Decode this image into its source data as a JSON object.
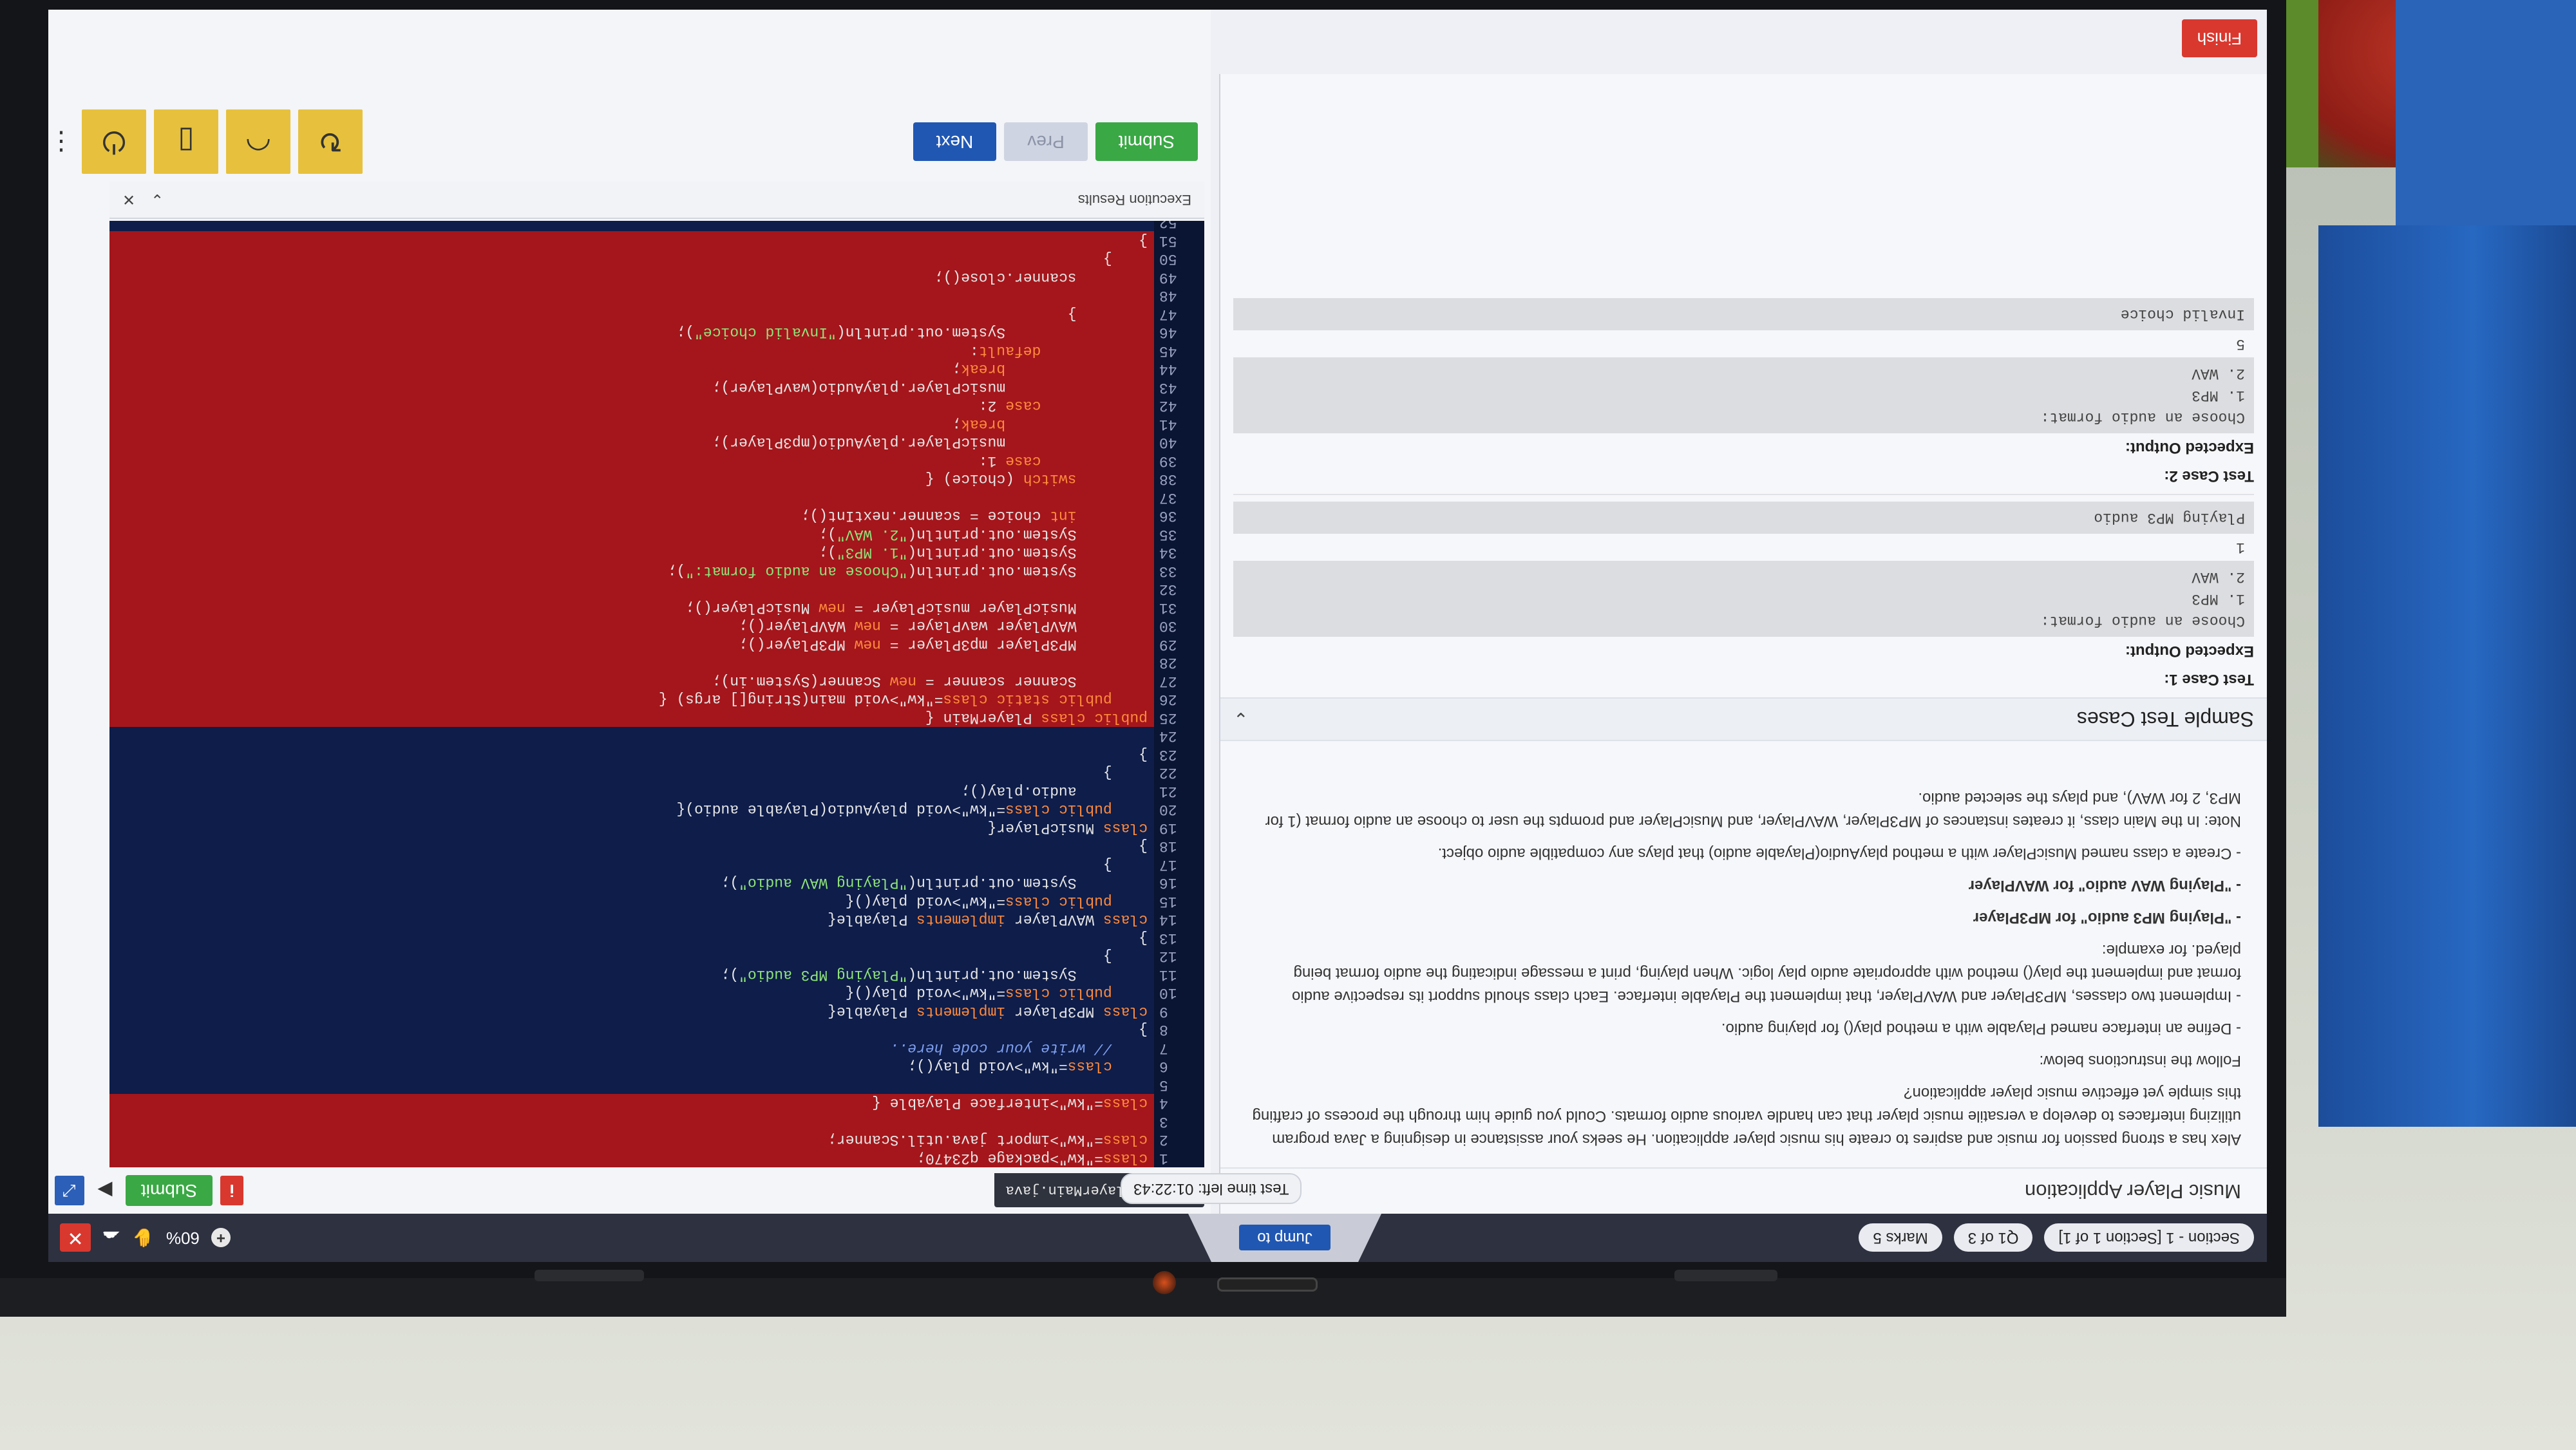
{
  "topbar": {
    "section": "Section - 1 [Section 1 of 1]",
    "question": "Q1 of 3",
    "marks": "Marks 5",
    "jump": "Jump to",
    "zoom": "60%",
    "timer": "Test time left: 01:22:43"
  },
  "question": {
    "title": "Music Player Application",
    "paragraphs": [
      "Alex has a strong passion for music and aspires to create his music player application. He seeks your assistance in designing a Java program utilizing interfaces to develop a versatile music player that can handle various audio formats. Could you guide him through the process of crafting this simple yet effective music player application?",
      "Follow the instructions below:",
      "- Define an interface named Playable with a method play() for playing audio.",
      "- Implement two classes, MP3Player and WAVPlayer, that implement the Playable interface. Each class should support its respective audio format and implement the play() method with appropriate audio play logic. When playing, print a message indicating the audio format being played. for example:",
      "- \"Playing MP3 audio\" for MP3Player",
      "- \"Playing WAV audio\" for WAVPlayer",
      "- Create a class named MusicPlayer with a method playAudio(Playable audio) that plays any compatible audio object.",
      "Note: In the Main class, it creates instances of MP3Player, WAVPlayer, and MusicPlayer and prompts the user to choose an audio format (1 for MP3, 2 for WAV), and plays the selected audio."
    ],
    "sample_title": "Sample Test Cases",
    "test_cases": [
      {
        "label": "Test Case 1:",
        "expected_label": "Expected Output:",
        "box1": "Choose an audio format:\n1. MP3\n2. WAV",
        "input": "1",
        "box2": "Playing MP3 audio"
      },
      {
        "label": "Test Case 2:",
        "expected_label": "Expected Output:",
        "box1": "Choose an audio format:\n1. MP3\n2. WAV",
        "input": "5",
        "box2": "Invalid choice"
      }
    ]
  },
  "editor": {
    "filename": "q23470/PlayerMain.java",
    "submit_small": "Submit",
    "results": "Execution Results",
    "lines": [
      {
        "n": "1",
        "t": "package q23470;",
        "hl": true
      },
      {
        "n": "2",
        "t": "import java.util.Scanner;",
        "hl": true
      },
      {
        "n": "3",
        "t": "",
        "hl": true
      },
      {
        "n": "4",
        "t": "interface Playable {",
        "hl": true
      },
      {
        "n": "5",
        "t": "",
        "hl": false
      },
      {
        "n": "6",
        "t": "    void play();",
        "hl": false
      },
      {
        "n": "7",
        "t": "    // write your code here..",
        "hl": false
      },
      {
        "n": "8",
        "t": "}",
        "hl": false
      },
      {
        "n": "9",
        "t": "class MP3Player implements Playable{",
        "hl": false
      },
      {
        "n": "10",
        "t": "    public void play(){",
        "hl": false
      },
      {
        "n": "11",
        "t": "        System.out.println(\"Playing MP3 audio\");",
        "hl": false
      },
      {
        "n": "12",
        "t": "    }",
        "hl": false
      },
      {
        "n": "13",
        "t": "}",
        "hl": false
      },
      {
        "n": "14",
        "t": "class WAVPlayer implements Playable{",
        "hl": false
      },
      {
        "n": "15",
        "t": "    public void play(){",
        "hl": false
      },
      {
        "n": "16",
        "t": "        System.out.println(\"Playing WAV audio\");",
        "hl": false
      },
      {
        "n": "17",
        "t": "    }",
        "hl": false
      },
      {
        "n": "18",
        "t": "}",
        "hl": false
      },
      {
        "n": "19",
        "t": "class MusicPlayer{",
        "hl": false
      },
      {
        "n": "20",
        "t": "    public void playAudio(Playable audio){",
        "hl": false
      },
      {
        "n": "21",
        "t": "        audio.play();",
        "hl": false
      },
      {
        "n": "22",
        "t": "    }",
        "hl": false
      },
      {
        "n": "23",
        "t": "}",
        "hl": false
      },
      {
        "n": "24",
        "t": "",
        "hl": false
      },
      {
        "n": "25",
        "t": "public class PlayerMain {",
        "hl": true
      },
      {
        "n": "26",
        "t": "    public static void main(String[] args) {",
        "hl": true
      },
      {
        "n": "27",
        "t": "        Scanner scanner = new Scanner(System.in);",
        "hl": true
      },
      {
        "n": "28",
        "t": "",
        "hl": true
      },
      {
        "n": "29",
        "t": "        MP3Player mp3Player = new MP3Player();",
        "hl": true
      },
      {
        "n": "30",
        "t": "        WAVPlayer wavPlayer = new WAVPlayer();",
        "hl": true
      },
      {
        "n": "31",
        "t": "        MusicPlayer musicPlayer = new MusicPlayer();",
        "hl": true
      },
      {
        "n": "32",
        "t": "",
        "hl": true
      },
      {
        "n": "33",
        "t": "        System.out.println(\"Choose an audio format:\");",
        "hl": true
      },
      {
        "n": "34",
        "t": "        System.out.println(\"1. MP3\");",
        "hl": true
      },
      {
        "n": "35",
        "t": "        System.out.println(\"2. WAV\");",
        "hl": true
      },
      {
        "n": "36",
        "t": "        int choice = scanner.nextInt();",
        "hl": true
      },
      {
        "n": "37",
        "t": "",
        "hl": true
      },
      {
        "n": "38",
        "t": "        switch (choice) {",
        "hl": true
      },
      {
        "n": "39",
        "t": "            case 1:",
        "hl": true
      },
      {
        "n": "40",
        "t": "                musicPlayer.playAudio(mp3Player);",
        "hl": true
      },
      {
        "n": "41",
        "t": "                break;",
        "hl": true
      },
      {
        "n": "42",
        "t": "            case 2:",
        "hl": true
      },
      {
        "n": "43",
        "t": "                musicPlayer.playAudio(wavPlayer);",
        "hl": true
      },
      {
        "n": "44",
        "t": "                break;",
        "hl": true
      },
      {
        "n": "45",
        "t": "            default:",
        "hl": true
      },
      {
        "n": "46",
        "t": "                System.out.println(\"Invalid choice\");",
        "hl": true
      },
      {
        "n": "47",
        "t": "        }",
        "hl": true
      },
      {
        "n": "48",
        "t": "",
        "hl": true
      },
      {
        "n": "49",
        "t": "        scanner.close();",
        "hl": true
      },
      {
        "n": "50",
        "t": "    }",
        "hl": true
      },
      {
        "n": "51",
        "t": "}",
        "hl": true
      },
      {
        "n": "52",
        "t": "",
        "hl": false
      }
    ]
  },
  "actions": {
    "submit": "Submit",
    "prev": "Prev",
    "next": "Next",
    "finish": "Finish"
  },
  "colors": {
    "accent_blue": "#2057b3",
    "submit_green": "#3aa845",
    "danger_red": "#d9382f",
    "editor_bg": "#0e1d4a",
    "highlight_red": "#a4161b"
  }
}
